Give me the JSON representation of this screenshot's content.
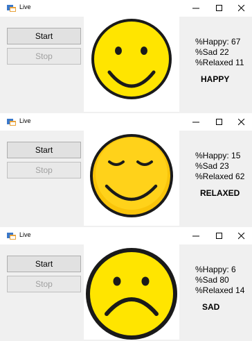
{
  "windows": [
    {
      "title": "Live",
      "start_label": "Start",
      "stop_label": "Stop",
      "happy": "%Happy: 67",
      "sad": "%Sad 22",
      "relaxed": "%Relaxed 11",
      "mood": "HAPPY"
    },
    {
      "title": "Live",
      "start_label": "Start",
      "stop_label": "Stop",
      "happy": "%Happy: 15",
      "sad": "%Sad 23",
      "relaxed": "%Relaxed 62",
      "mood": "RELAXED"
    },
    {
      "title": "Live",
      "start_label": "Start",
      "stop_label": "Stop",
      "happy": "%Happy: 6",
      "sad": "%Sad 80",
      "relaxed": "%Relaxed 14",
      "mood": "SAD"
    }
  ],
  "icons": {
    "app": "app-window-icon",
    "minimize": "minimize-icon",
    "maximize": "maximize-icon",
    "close": "close-icon"
  },
  "colors": {
    "face": "#ffe500",
    "relaxed_face": "#f9c40a",
    "outline": "#1a1a1a"
  }
}
